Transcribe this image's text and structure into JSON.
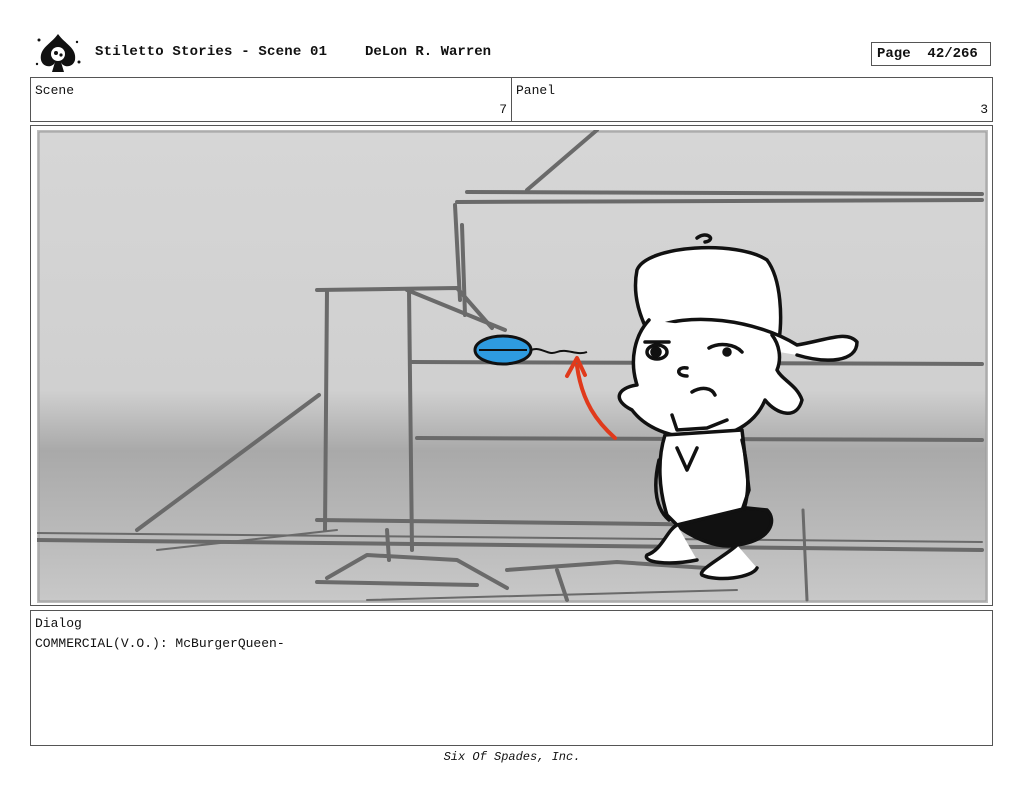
{
  "header": {
    "title": "Stiletto Stories - Scene 01",
    "author": "DeLon R. Warren",
    "page_label": "Page",
    "page_value": "42/266"
  },
  "scene": {
    "label": "Scene",
    "value": "7"
  },
  "panel": {
    "label": "Panel",
    "value": "3"
  },
  "dialog": {
    "label": "Dialog",
    "line": "COMMERCIAL(V.O.): McBurgerQueen-"
  },
  "footer": {
    "company": "Six Of Spades, Inc."
  },
  "colors": {
    "arrow": "#e03a1c",
    "object": "#2e9be0",
    "sketch": "#6a6a6a"
  }
}
